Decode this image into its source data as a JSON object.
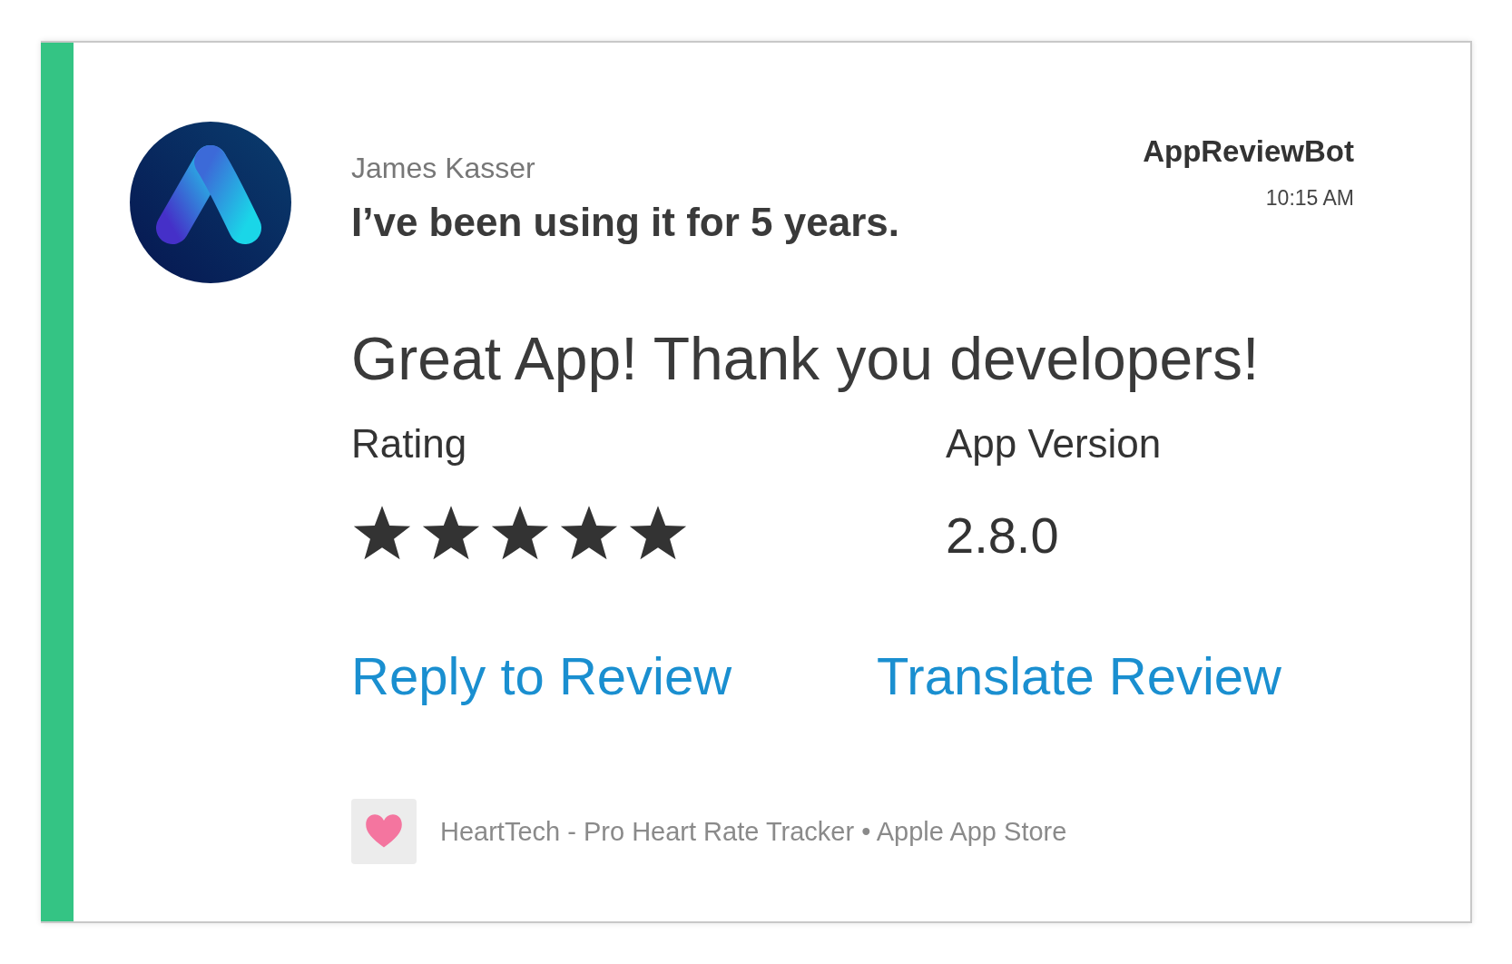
{
  "header": {
    "author": "James Kasser",
    "title": "I’ve been using it for 5 years.",
    "bot": "AppReviewBot",
    "time": "10:15 AM"
  },
  "message": "Great App! Thank you developers!",
  "fields": [
    {
      "kind": "stars",
      "label": "Rating",
      "stars": 5
    },
    {
      "kind": "text",
      "label": "App Version",
      "value": "2.8.0"
    }
  ],
  "actions": [
    {
      "label": "Reply to Review"
    },
    {
      "label": "Translate Review"
    }
  ],
  "footer": {
    "text": "HeartTech - Pro Heart Rate Tracker • Apple App Store"
  }
}
